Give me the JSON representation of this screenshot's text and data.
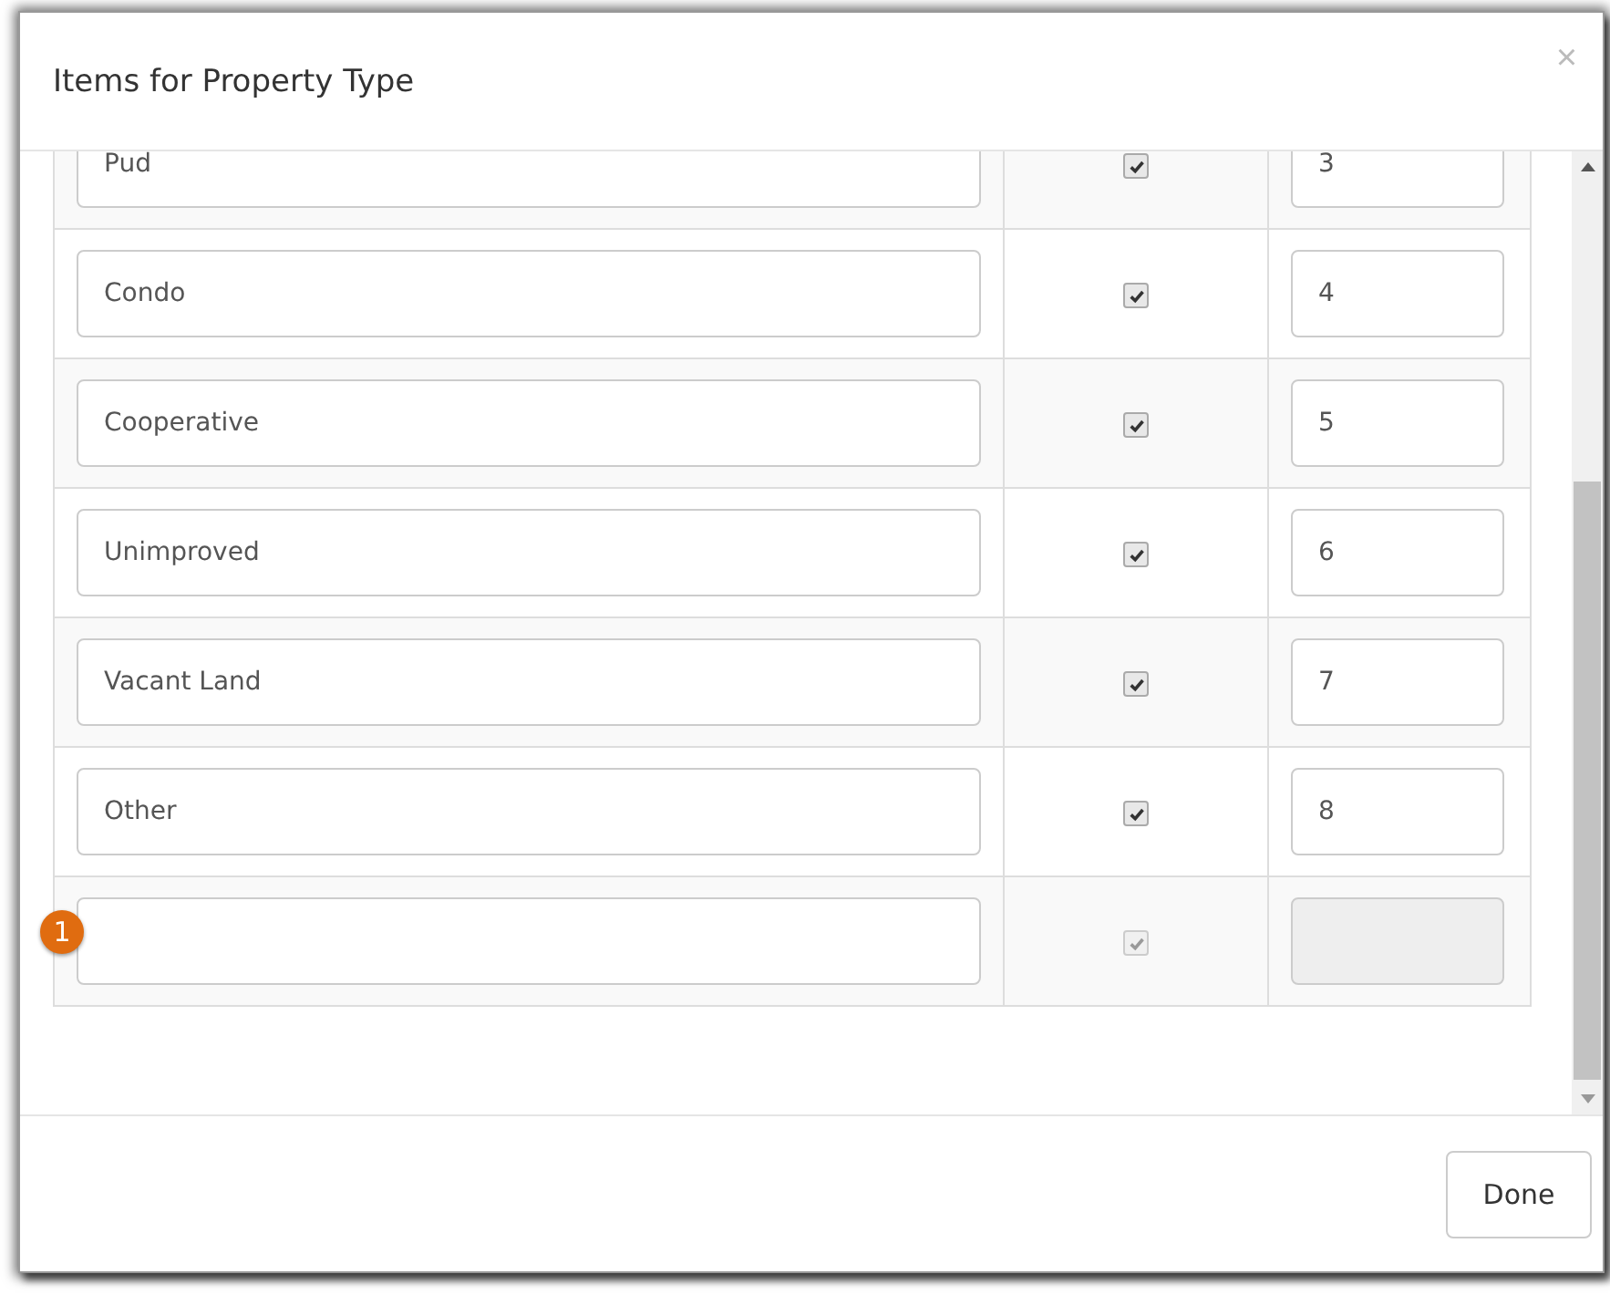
{
  "dialog": {
    "title": "Items for Property Type",
    "close": "×"
  },
  "rows": [
    {
      "name": "Pud",
      "checked": true,
      "disabled": false,
      "order": "3"
    },
    {
      "name": "Condo",
      "checked": true,
      "disabled": false,
      "order": "4"
    },
    {
      "name": "Cooperative",
      "checked": true,
      "disabled": false,
      "order": "5"
    },
    {
      "name": "Unimproved",
      "checked": true,
      "disabled": false,
      "order": "6"
    },
    {
      "name": "Vacant Land",
      "checked": true,
      "disabled": false,
      "order": "7"
    },
    {
      "name": "Other",
      "checked": true,
      "disabled": false,
      "order": "8"
    },
    {
      "badge": "1",
      "checked": true,
      "disabled": true
    }
  ],
  "footer": {
    "button": "Done"
  }
}
